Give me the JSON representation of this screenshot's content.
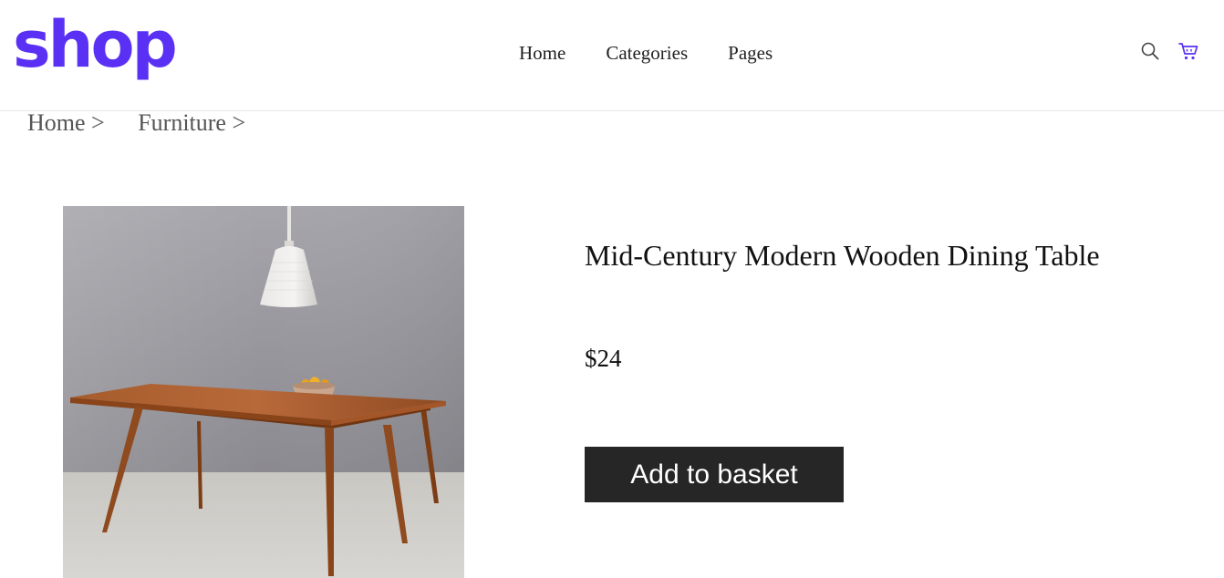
{
  "header": {
    "logo_text": "shop",
    "nav": [
      "Home",
      "Categories",
      "Pages"
    ],
    "icons": {
      "search": "search-icon",
      "cart": "cart-icon"
    },
    "brand_color": "#5a31f4"
  },
  "breadcrumb": [
    "Home >",
    "Furniture >"
  ],
  "product": {
    "title": "Mid-Century Modern Wooden Dining Table",
    "price": "$24",
    "add_label": "Add to basket",
    "button_color": "#262626"
  }
}
